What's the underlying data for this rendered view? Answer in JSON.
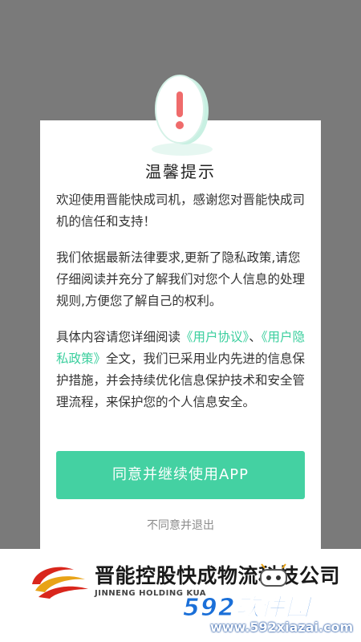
{
  "dialog": {
    "title": "温馨提示",
    "para1": "欢迎使用晋能快成司机，感谢您对晋能快成司机的信任和支持！",
    "para2": "我们依据最新法律要求,更新了隐私政策,请您仔细阅读并充分了解我们对您个人信息的处理规则,方便您了解自己的权利。",
    "para3_prefix": "具体内容请您详细阅读",
    "user_agreement_link": "《用户协议》",
    "separator": "、",
    "privacy_policy_link": "《用户隐私政策》",
    "para3_suffix": "全文，我们已采用业内先进的信息保护措施，并会持续优化信息保护技术和安全管理流程，来保护您的个人信息安全。",
    "agree_button": "同意并继续使用APP",
    "disagree_link": "不同意并退出"
  },
  "background_brand": {
    "company_cn": "晋能控股快成物流科技公司",
    "company_en": "JINNENG HOLDING KUA"
  },
  "watermark": {
    "brand": "592软件园",
    "url": "www.592xiazai.com"
  },
  "colors": {
    "overlay": "#7a7a7a",
    "accent": "#44d1a2",
    "link": "#3bcf9e",
    "watermark_blue": "#1a6fd8"
  },
  "icons": {
    "alert": "exclamation-alert-icon",
    "logo": "company-logo",
    "mascot": "watermark-mascot-icon"
  }
}
